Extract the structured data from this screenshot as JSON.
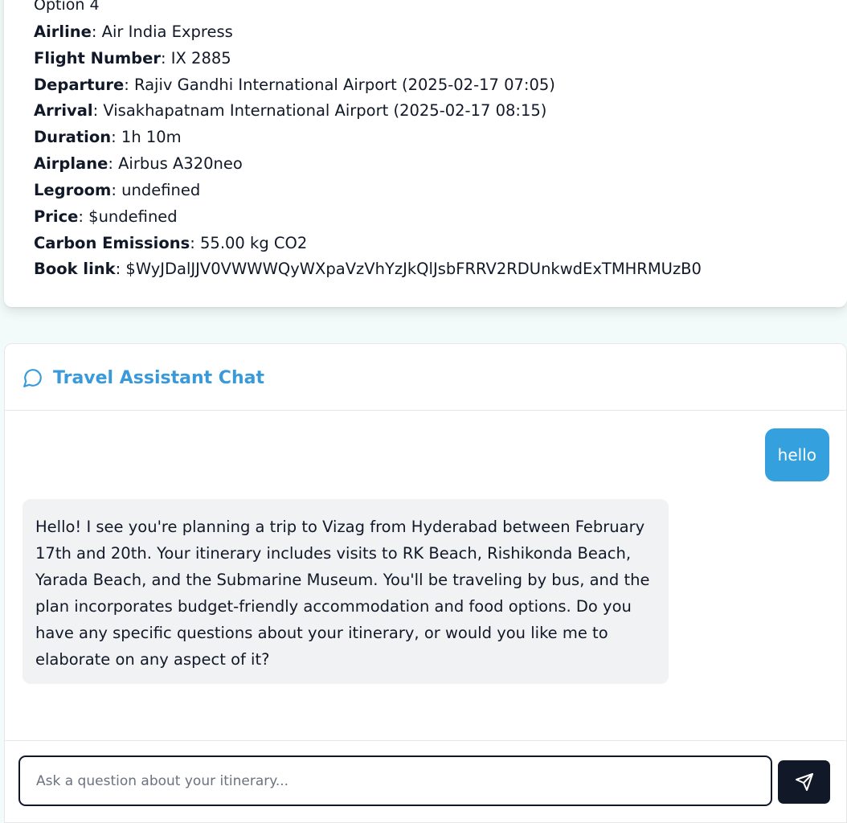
{
  "flight": {
    "option_title": "Option 4",
    "fields": [
      {
        "label": "Airline",
        "value": ": Air India Express"
      },
      {
        "label": "Flight Number",
        "value": ": IX 2885"
      },
      {
        "label": "Departure",
        "value": ": Rajiv Gandhi International Airport (2025-02-17 07:05)"
      },
      {
        "label": "Arrival",
        "value": ": Visakhapatnam International Airport (2025-02-17 08:15)"
      },
      {
        "label": "Duration",
        "value": ": 1h 10m"
      },
      {
        "label": "Airplane",
        "value": ": Airbus A320neo"
      },
      {
        "label": "Legroom",
        "value": ": undefined"
      },
      {
        "label": "Price",
        "value": ": $undefined"
      },
      {
        "label": "Carbon Emissions",
        "value": ": 55.00 kg CO2"
      },
      {
        "label": "Book link",
        "value": ": $WyJDalJJV0VWWWQyWXpaVzVhYzJkQlJsbFRRV2RDUnkwdExTMHRMUzB0"
      }
    ]
  },
  "chat": {
    "title": "Travel Assistant Chat",
    "title_icon": "message-circle-icon",
    "messages": [
      {
        "role": "user",
        "text": "hello"
      },
      {
        "role": "assistant",
        "text": "Hello! I see you're planning a trip to Vizag from Hyderabad between February 17th and 20th. Your itinerary includes visits to RK Beach, Rishikonda Beach, Yarada Beach, and the Submarine Museum. You'll be traveling by bus, and the plan incorporates budget-friendly accommodation and food options. Do you have any specific questions about your itinerary, or would you like me to elaborate on any aspect of it?"
      }
    ],
    "input": {
      "placeholder": "Ask a question about your itinerary...",
      "value": ""
    },
    "send_icon": "send-icon"
  },
  "colors": {
    "accent": "#3a9ad9",
    "user_bubble": "#34a0dd",
    "assistant_bubble": "#f1f2f4",
    "send_button": "#111827",
    "page_background": "#f3fafa"
  }
}
